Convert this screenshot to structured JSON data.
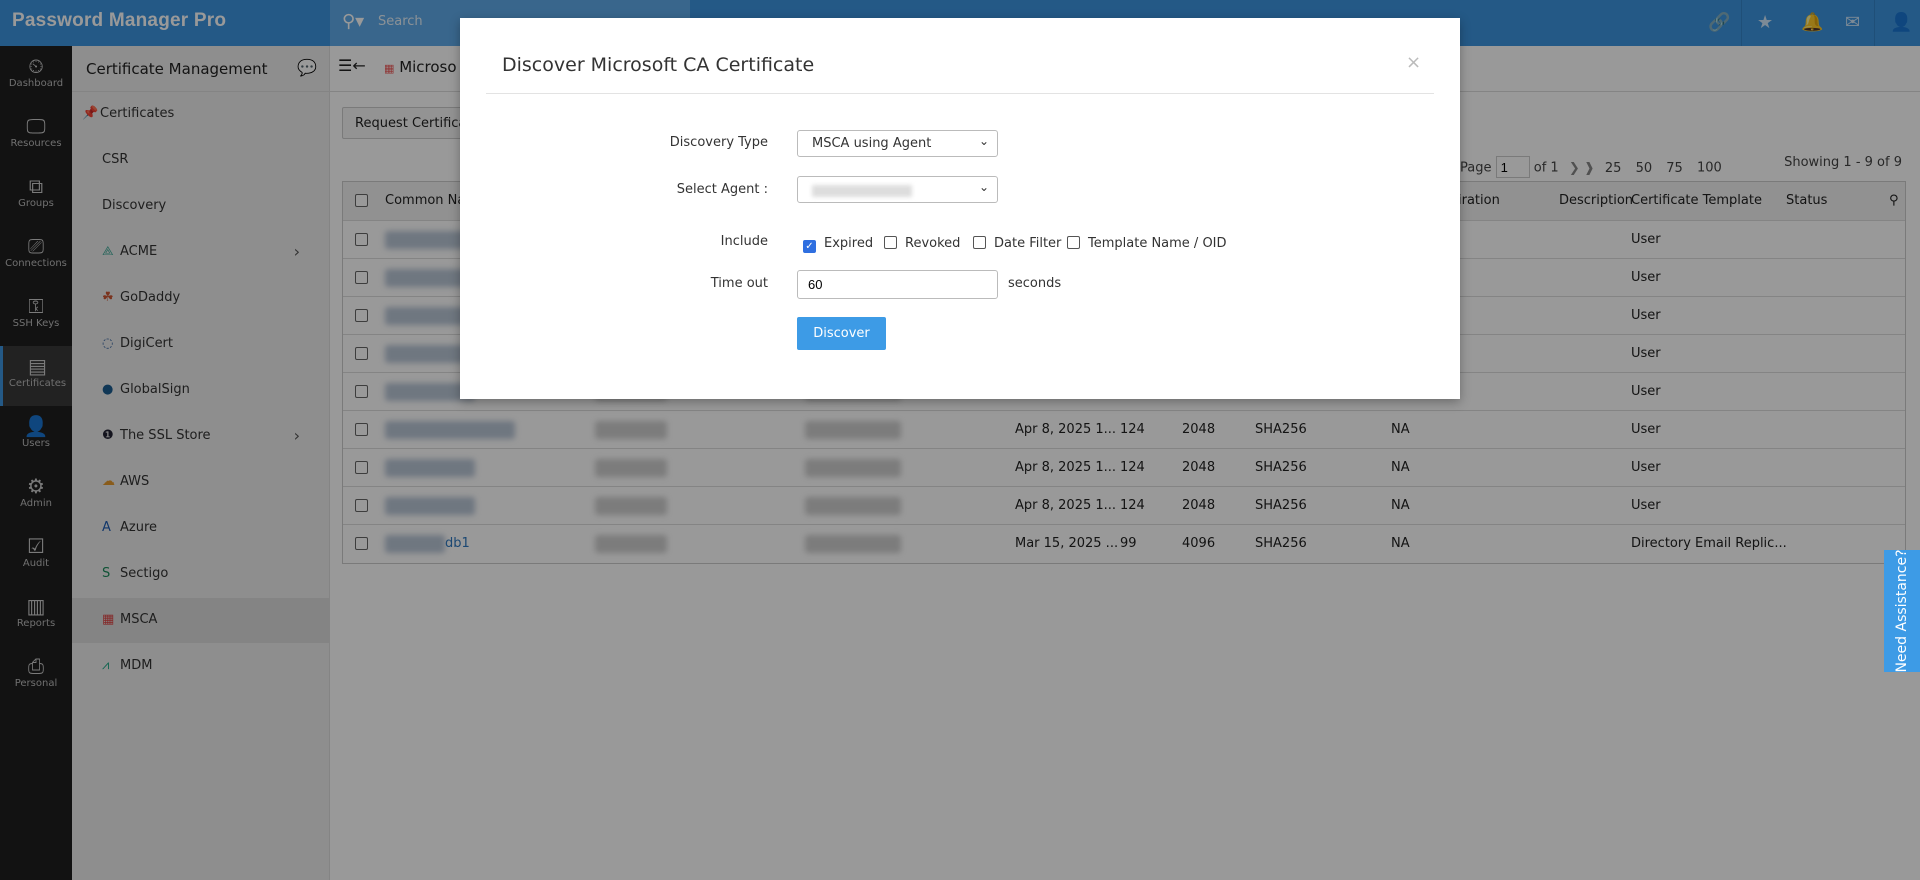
{
  "app": {
    "title": "Password Manager Pro",
    "search_placeholder": "Search"
  },
  "topbar_icons": [
    "link-icon",
    "favorite-user-icon",
    "bell-icon",
    "mail-icon",
    "user-menu-icon"
  ],
  "nav": [
    {
      "label": "Dashboard",
      "icon": "⏲"
    },
    {
      "label": "Resources",
      "icon": "🖵"
    },
    {
      "label": "Groups",
      "icon": "⧉"
    },
    {
      "label": "Connections",
      "icon": "⎚"
    },
    {
      "label": "SSH Keys",
      "icon": "⚿"
    },
    {
      "label": "Certificates",
      "icon": "▤",
      "active": true
    },
    {
      "label": "Users",
      "icon": "👤"
    },
    {
      "label": "Admin",
      "icon": "⚙"
    },
    {
      "label": "Audit",
      "icon": "☑"
    },
    {
      "label": "Reports",
      "icon": "▥"
    },
    {
      "label": "Personal",
      "icon": "⎙"
    }
  ],
  "sidebar": {
    "title": "Certificate Management",
    "items": [
      {
        "label": "Certificates"
      },
      {
        "label": "CSR"
      },
      {
        "label": "Discovery"
      },
      {
        "label": "ACME"
      },
      {
        "label": "GoDaddy"
      },
      {
        "label": "DigiCert"
      },
      {
        "label": "GlobalSign"
      },
      {
        "label": "The SSL Store"
      },
      {
        "label": "AWS"
      },
      {
        "label": "Azure"
      },
      {
        "label": "Sectigo"
      },
      {
        "label": "MSCA"
      },
      {
        "label": "MDM"
      }
    ]
  },
  "main": {
    "breadcrumb": "Microso",
    "request_button": "Request Certificat",
    "pager": {
      "page_label": "Page",
      "page": "1",
      "of": "of 1",
      "sizes": [
        "25",
        "50",
        "75",
        "100"
      ],
      "showing": "Showing 1 - 9 of 9"
    },
    "columns": {
      "common_name": "Common Na",
      "expiration": "iration",
      "description": "Description",
      "template": "Certificate Template",
      "status": "Status"
    },
    "rows": [
      {
        "template": "User"
      },
      {
        "template": "User"
      },
      {
        "template": "User"
      },
      {
        "template": "User"
      },
      {
        "template": "User"
      },
      {
        "expiry": "Apr 8, 2025 1...",
        "days": "124",
        "key": "2048",
        "alg": "SHA256",
        "na": "NA",
        "template": "User"
      },
      {
        "expiry": "Apr 8, 2025 1...",
        "days": "124",
        "key": "2048",
        "alg": "SHA256",
        "na": "NA",
        "template": "User"
      },
      {
        "expiry": "Apr 8, 2025 1...",
        "days": "124",
        "key": "2048",
        "alg": "SHA256",
        "na": "NA",
        "template": "User"
      },
      {
        "name_suffix": "db1",
        "expiry": "Mar 15, 2025 ...",
        "days": "99",
        "key": "4096",
        "alg": "SHA256",
        "na": "NA",
        "template": "Directory Email Replic..."
      }
    ]
  },
  "modal": {
    "title": "Discover Microsoft CA Certificate",
    "close": "×",
    "discovery_type_label": "Discovery Type",
    "discovery_type_value": "MSCA using Agent",
    "agent_label": "Select Agent :",
    "include_label": "Include",
    "include": [
      {
        "label": "Expired",
        "checked": true
      },
      {
        "label": "Revoked",
        "checked": false
      },
      {
        "label": "Date Filter",
        "checked": false
      },
      {
        "label": "Template Name / OID",
        "checked": false
      }
    ],
    "timeout_label": "Time out",
    "timeout_value": "60",
    "timeout_unit": "seconds",
    "discover_button": "Discover"
  },
  "assist": "Need Assistance?",
  "colors": {
    "brand": "#3d95e0",
    "button": "#3d9be6",
    "checkbox": "#2f6fe0"
  }
}
